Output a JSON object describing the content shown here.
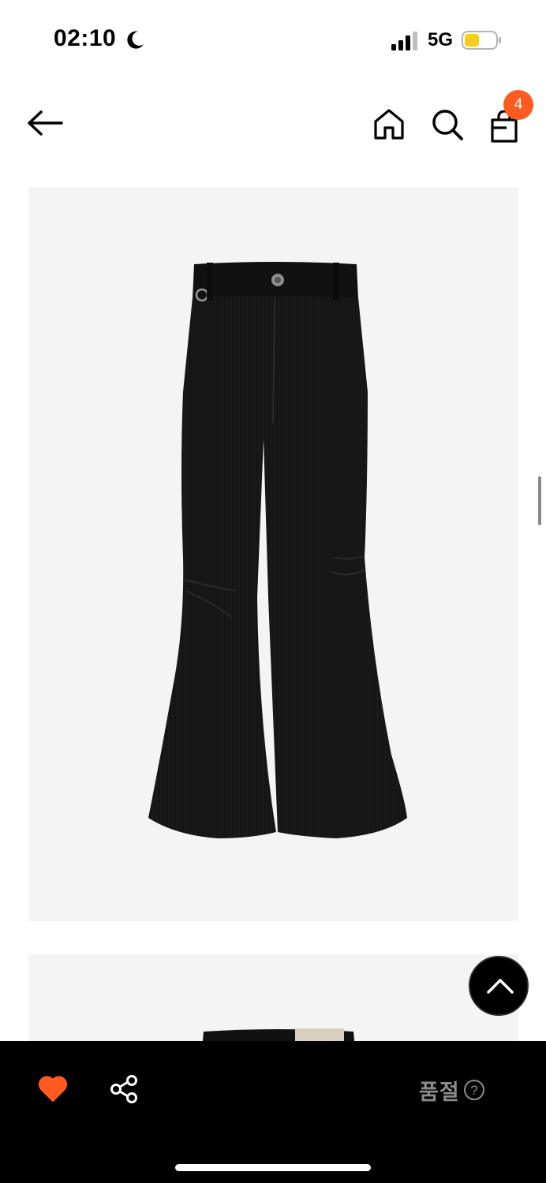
{
  "status_bar": {
    "time": "02:10",
    "network": "5G",
    "icons": [
      "moon-icon",
      "signal-icon",
      "battery-icon"
    ]
  },
  "nav": {
    "icons": [
      "back-arrow-icon",
      "home-icon",
      "search-icon",
      "shopping-bag-icon"
    ],
    "cart_count": "4"
  },
  "product": {
    "images": [
      "black-corduroy-flared-pants-image",
      "product-image-2"
    ]
  },
  "bottom_bar": {
    "soldout_label": "품절",
    "icons": [
      "heart-icon",
      "share-icon",
      "help-icon",
      "scroll-top-icon"
    ]
  },
  "colors": {
    "accent": "#ff5a1f",
    "bottom_bar_bg": "#000000",
    "image_bg": "#f4f4f4",
    "soldout_text": "#8c8c8c"
  }
}
